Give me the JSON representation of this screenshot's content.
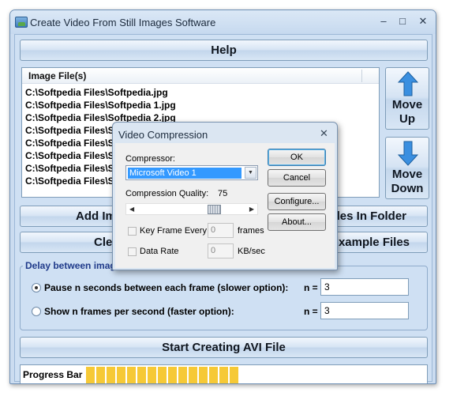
{
  "window": {
    "title": "Create Video From Still Images Software",
    "controls": [
      "–",
      "□",
      "✕"
    ]
  },
  "help_button": "Help",
  "file_list": {
    "header": "Image File(s)",
    "rows": [
      "C:\\Softpedia Files\\Softpedia.jpg",
      "C:\\Softpedia Files\\Softpedia 1.jpg",
      "C:\\Softpedia Files\\Softpedia 2.jpg",
      "C:\\Softpedia Files\\So",
      "C:\\Softpedia Files\\So",
      "C:\\Softpedia Files\\So",
      "C:\\Softpedia Files\\So",
      "C:\\Softpedia Files\\So"
    ]
  },
  "move_up": "Move Up",
  "move_down": "Move Down",
  "row1_left": "Add Im",
  "row1_right": "les In Folder",
  "row2_left": "Cle",
  "row2_right": "xample Files",
  "delay_group": {
    "title": "Delay between imag",
    "option1": "Pause n seconds between each frame (slower option):",
    "option2": "Show n frames per second (faster option):",
    "n_label": "n =",
    "n1": "3",
    "n2": "3",
    "selected": 1
  },
  "start_button": "Start Creating AVI File",
  "progress": {
    "label": "Progress Bar",
    "segments": 15
  },
  "dialog": {
    "title": "Video Compression",
    "close": "✕",
    "compressor_label": "Compressor:",
    "compressor_value": "Microsoft Video 1",
    "quality_label": "Compression Quality:",
    "quality_value": "75",
    "keyframe_label": "Key Frame Every",
    "keyframe_value": "0",
    "keyframe_unit": "frames",
    "datarate_label": "Data Rate",
    "datarate_value": "0",
    "datarate_unit": "KB/sec",
    "ok": "OK",
    "cancel": "Cancel",
    "configure": "Configure...",
    "about": "About..."
  }
}
